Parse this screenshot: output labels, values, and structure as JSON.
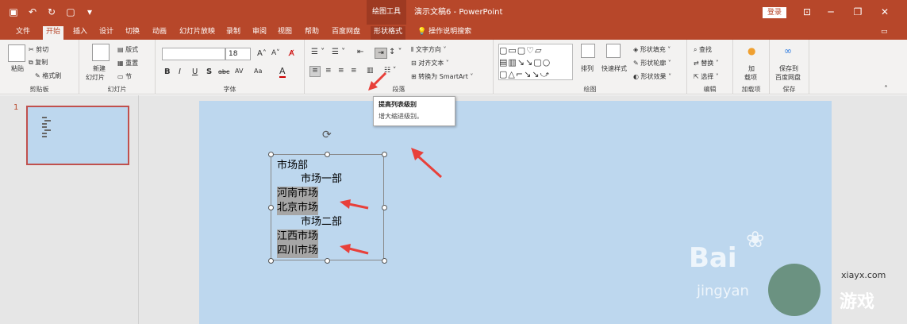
{
  "titlebar": {
    "context_tools": "绘图工具",
    "doc_title": "演示文稿6 - PowerPoint",
    "login": "登录"
  },
  "tabs": [
    "文件",
    "开始",
    "插入",
    "设计",
    "切换",
    "动画",
    "幻灯片放映",
    "录制",
    "审阅",
    "视图",
    "帮助",
    "百度网盘",
    "形状格式",
    "操作说明搜索"
  ],
  "ribbon": {
    "clipboard": {
      "paste": "粘贴",
      "cut": "剪切",
      "copy": "复制",
      "painter": "格式刷",
      "label": "剪贴板"
    },
    "slides": {
      "new_slide_1": "新建",
      "new_slide_2": "幻灯片",
      "layout": "版式",
      "reset": "重置",
      "section": "节",
      "label": "幻灯片"
    },
    "font": {
      "size": "18",
      "label": "字体",
      "bold": "B",
      "italic": "I",
      "underline": "U",
      "shadow": "S",
      "strike": "abc",
      "spacing": "AV",
      "case": "Aa",
      "color": "A"
    },
    "paragraph": {
      "text_direction": "文字方向",
      "align_text": "对齐文本",
      "smartart": "转换为 SmartArt",
      "label": "段落"
    },
    "drawing": {
      "arrange": "排列",
      "quick_styles": "快速样式",
      "fill": "形状填充",
      "outline": "形状轮廓",
      "effects": "形状效果",
      "label": "绘图"
    },
    "editing": {
      "find": "查找",
      "replace": "替换",
      "select": "选择",
      "label": "编辑"
    },
    "addins": {
      "load_1": "加",
      "load_2": "载项",
      "label": "加载项"
    },
    "save": {
      "save_1": "保存到",
      "save_2": "百度网盘",
      "label": "保存"
    }
  },
  "tooltip": {
    "title": "提高列表级别",
    "description": "增大缩进级别。"
  },
  "thumbnail": {
    "number": "1"
  },
  "textbox": {
    "lines": [
      "市场部",
      "市场一部",
      "河南市场",
      "北京市场",
      "市场二部",
      "江西市场",
      "四川市场"
    ]
  },
  "watermark": {
    "baidu": "Bai",
    "jingyan": "jingyan",
    "site": "xiayx.com",
    "game": "游戏"
  },
  "colors": {
    "accent": "#b7472a",
    "slide_bg": "#bdd7ee",
    "arrow": "#e8403a"
  }
}
